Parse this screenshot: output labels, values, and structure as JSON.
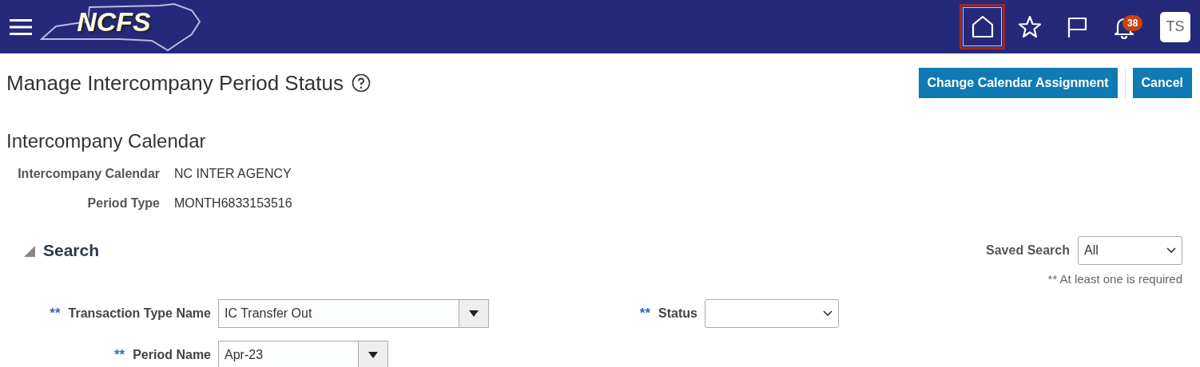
{
  "header": {
    "logo": "NCFS",
    "nav_icons": [
      {
        "kind": "home",
        "selected": true
      },
      {
        "kind": "star",
        "selected": false
      },
      {
        "kind": "flag",
        "selected": false
      }
    ],
    "notifications": {
      "count": "38"
    },
    "avatar": "TS"
  },
  "page": {
    "title": "Manage Intercompany Period Status"
  },
  "buttons": [
    "Change Calendar Assignment",
    "Cancel"
  ],
  "calendar": {
    "title": "Intercompany Calendar",
    "fields": [
      {
        "label": "Intercompany Calendar",
        "value": "NC INTER AGENCY"
      },
      {
        "label": "Period Type",
        "value": "MONTH6833153516"
      }
    ]
  },
  "search": {
    "title": "Search",
    "expanded": true,
    "saved_search": {
      "label": "Saved Search",
      "value": "All"
    },
    "required_note": "** At least one is required",
    "fields": [
      {
        "label": "Transaction Type Name",
        "marker": "**",
        "kind": "combo",
        "value": "IC Transfer Out"
      },
      {
        "label": "Status",
        "marker": "**",
        "kind": "select"
      },
      {
        "label": "Period Name",
        "marker": "**",
        "kind": "combo",
        "value": "Apr-23"
      }
    ]
  }
}
